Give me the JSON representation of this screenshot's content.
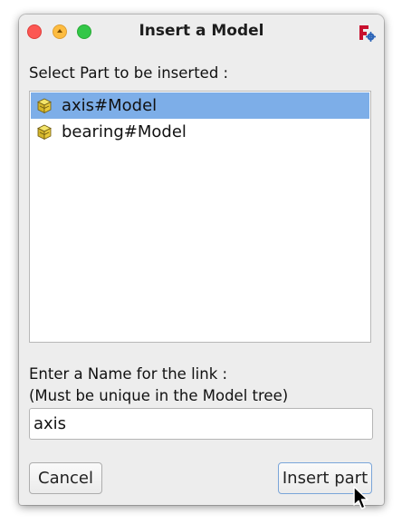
{
  "window": {
    "title": "Insert a Model"
  },
  "parts_section": {
    "label": "Select Part to be inserted :",
    "items": [
      {
        "label": "axis#Model",
        "icon": "part-icon",
        "selected": true
      },
      {
        "label": "bearing#Model",
        "icon": "part-icon",
        "selected": false
      }
    ]
  },
  "name_section": {
    "label_line1": "Enter a Name for the link :",
    "label_line2": "(Must be unique in the Model tree)",
    "value": "axis"
  },
  "buttons": {
    "cancel": "Cancel",
    "insert": "Insert part"
  },
  "colors": {
    "selection": "#7daee8",
    "window_bg": "#ededed",
    "close": "#fc5753",
    "minimize": "#fdbc40",
    "maximize": "#33c748"
  }
}
